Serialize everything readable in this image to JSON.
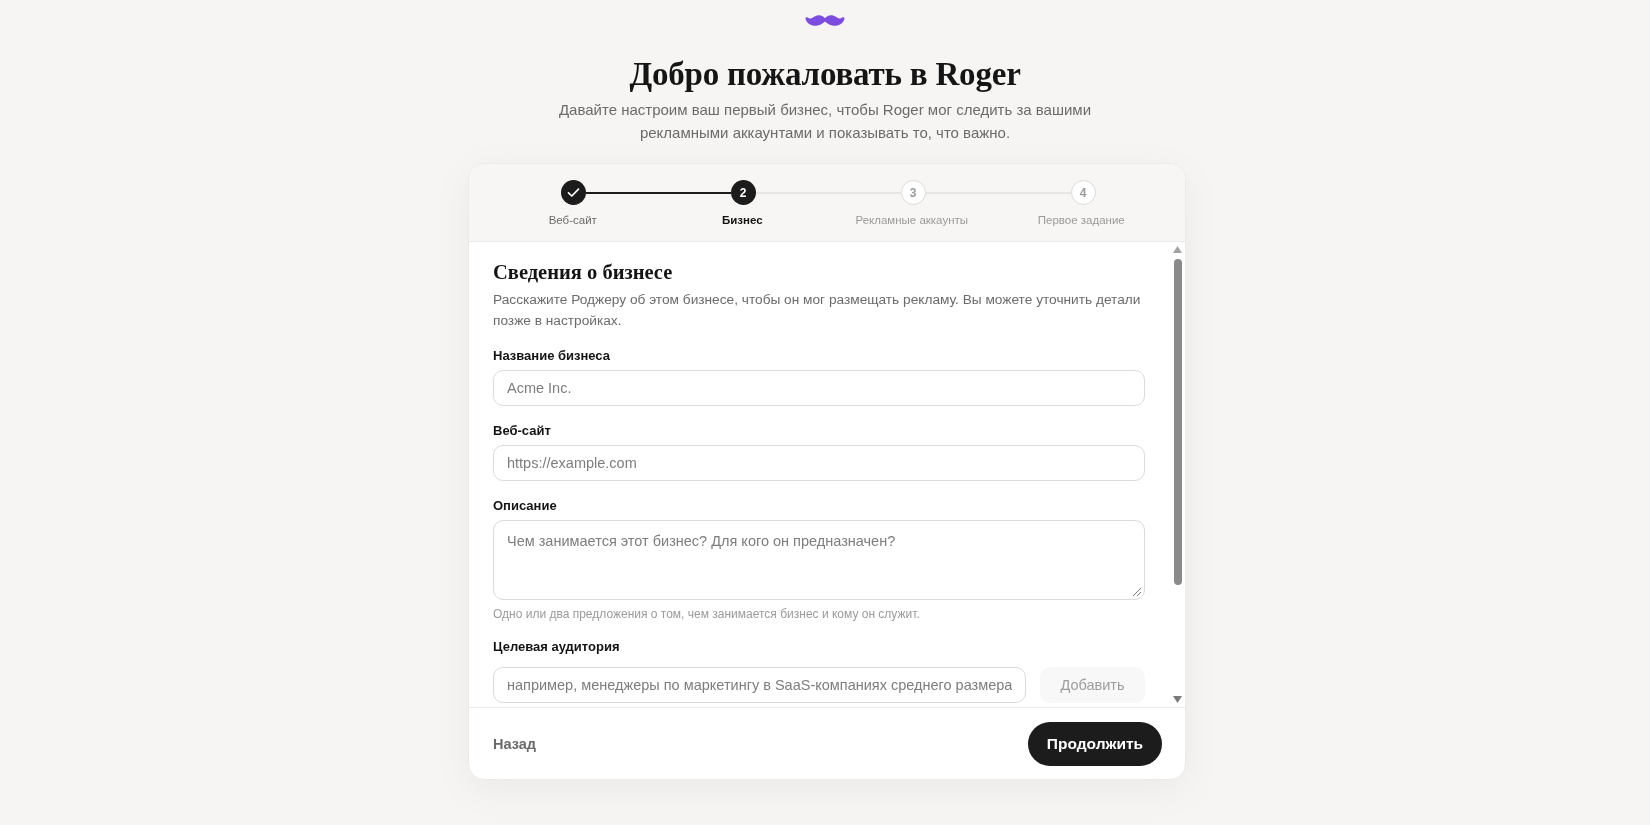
{
  "header": {
    "title": "Добро пожаловать в Roger",
    "subtitle": "Давайте настроим ваш первый бизнес, чтобы Roger мог следить за вашими рекламными аккаунтами и показывать то, что важно."
  },
  "steps": [
    {
      "label": "Веб-сайт",
      "completed": true,
      "selected": false
    },
    {
      "number": "2",
      "label": "Бизнес",
      "completed": false,
      "selected": true
    },
    {
      "number": "3",
      "label": "Рекламные аккаунты",
      "completed": false,
      "selected": false
    },
    {
      "number": "4",
      "label": "Первое задание",
      "completed": false,
      "selected": false
    }
  ],
  "form": {
    "title": "Сведения о бизнесе",
    "description": "Расскажите Роджеру об этом бизнесе, чтобы он мог размещать рекламу. Вы можете уточнить детали позже в настройках.",
    "fields": [
      {
        "kind": "input",
        "label": "Название бизнеса",
        "placeholder": "Acme Inc."
      },
      {
        "kind": "input",
        "label": "Веб-сайт",
        "placeholder": "https://example.com"
      },
      {
        "kind": "textarea",
        "label": "Описание",
        "placeholder": "Чем занимается этот бизнес? Для кого он предназначен?",
        "hint": "Одно или два предложения о том, чем занимается бизнес и кому он служит."
      },
      {
        "kind": "input_with_button",
        "label": "Целевая аудитория",
        "placeholder": "например, менеджеры по маркетингу в SaaS-компаниях среднего размера",
        "button": {
          "label": "Добавить",
          "disabled": true
        }
      }
    ]
  },
  "footer": {
    "back_button": "Назад",
    "continue_button": "Продолжить"
  }
}
